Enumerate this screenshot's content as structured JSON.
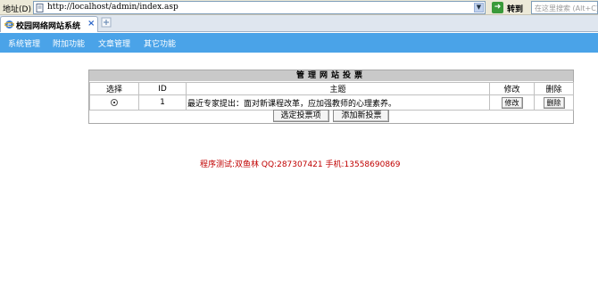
{
  "browser": {
    "address_label": "地址(D)",
    "url": "http://localhost/admin/index.asp",
    "go_label": "转到",
    "search_placeholder": "在这里搜索 (Alt+C)",
    "tab_title": "校园网络网站系统",
    "tab_close": "×"
  },
  "nav": {
    "items": [
      "系统管理",
      "附加功能",
      "文章管理",
      "其它功能"
    ]
  },
  "panel": {
    "title": "管理网站投票",
    "columns": [
      "选择",
      "ID",
      "主题",
      "修改",
      "删除"
    ],
    "rows": [
      {
        "selected": true,
        "id": "1",
        "topic": "最近专家提出：面对新课程改革，应加强教师的心理素养。",
        "edit": "修改",
        "delete": "删除"
      }
    ],
    "buttons": {
      "set_vote": "选定投票项",
      "add_vote": "添加新投票"
    }
  },
  "footer": "程序测试:双鱼林 QQ:287307421 手机:13558690869",
  "colors": {
    "nav_bg": "#4aa3e8",
    "footer_text": "#c00000",
    "panel_head": "#c9c9c9"
  }
}
